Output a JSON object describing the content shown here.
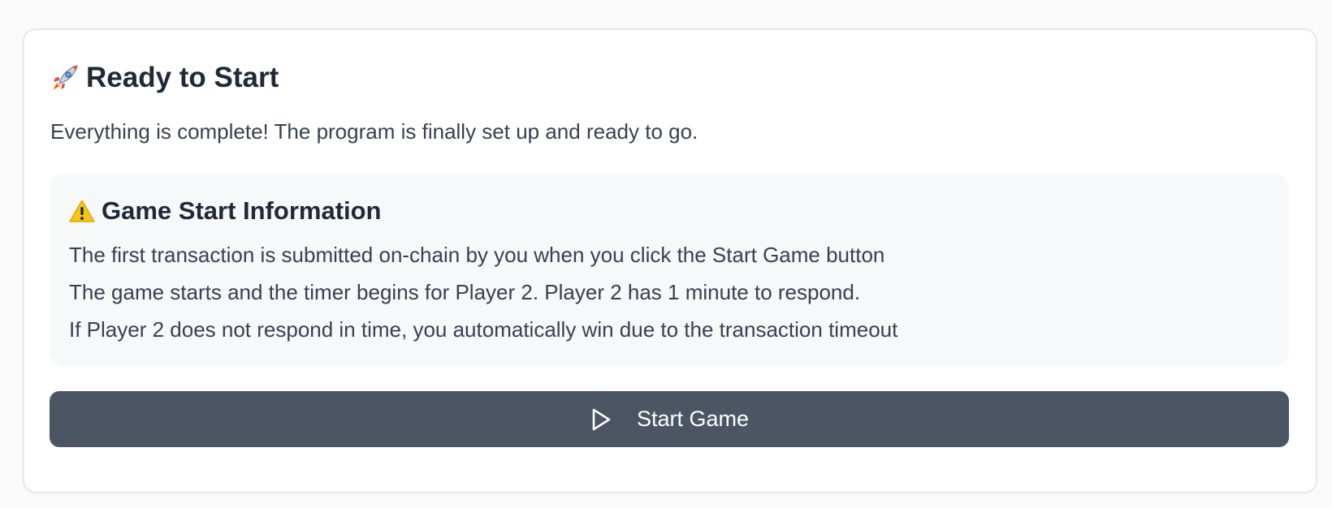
{
  "card": {
    "title": "Ready to Start",
    "title_icon": "rocket-icon",
    "description": "Everything is complete! The program is finally set up and ready to go."
  },
  "info": {
    "title": "Game Start Information",
    "title_icon": "warning-icon",
    "lines": [
      "The first transaction is submitted on-chain by you when you click the Start Game button",
      "The game starts and the timer begins for Player 2. Player 2 has 1 minute to respond.",
      "If Player 2 does not respond in time, you automatically win due to the transaction timeout"
    ]
  },
  "button": {
    "label": "Start Game",
    "icon": "play-icon"
  },
  "colors": {
    "button_bg": "#4b5563",
    "info_bg": "#f7f8fa",
    "heading": "#1f2937",
    "body_text": "#374151"
  }
}
